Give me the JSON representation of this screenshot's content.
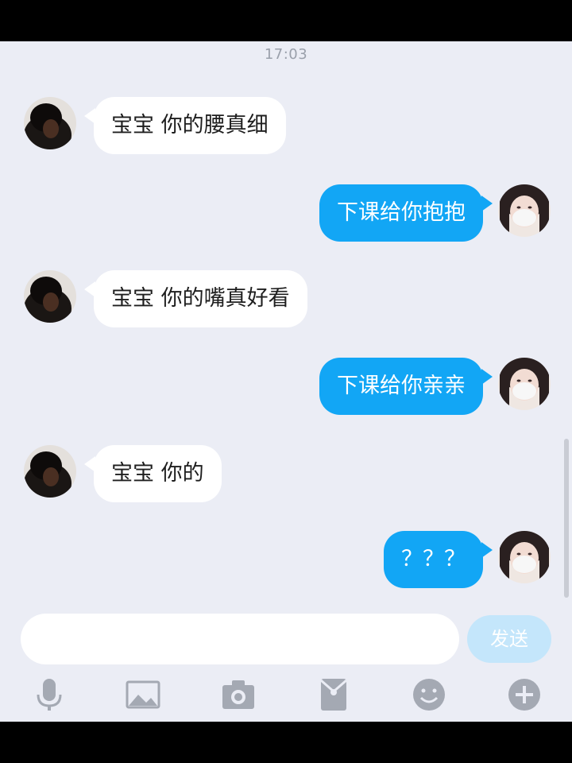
{
  "chat": {
    "timestamp": "17:03",
    "messages": [
      {
        "side": "in",
        "text": "宝宝  你的腰真细"
      },
      {
        "side": "out",
        "text": "下课给你抱抱"
      },
      {
        "side": "in",
        "text": "宝宝  你的嘴真好看"
      },
      {
        "side": "out",
        "text": "下课给你亲亲"
      },
      {
        "side": "in",
        "text": "宝宝  你的"
      },
      {
        "side": "out",
        "text": "？？？"
      }
    ]
  },
  "composer": {
    "input_value": "",
    "send_label": "发送"
  },
  "toolbar": {
    "icons": [
      "microphone-icon",
      "image-icon",
      "camera-icon",
      "red-packet-icon",
      "emoji-icon",
      "plus-icon"
    ]
  },
  "colors": {
    "background": "#ebedf5",
    "outgoing_bubble": "#12a6f5",
    "incoming_bubble": "#ffffff",
    "send_button_disabled": "#c4e6fb",
    "icon_gray": "#a4a9b3"
  }
}
